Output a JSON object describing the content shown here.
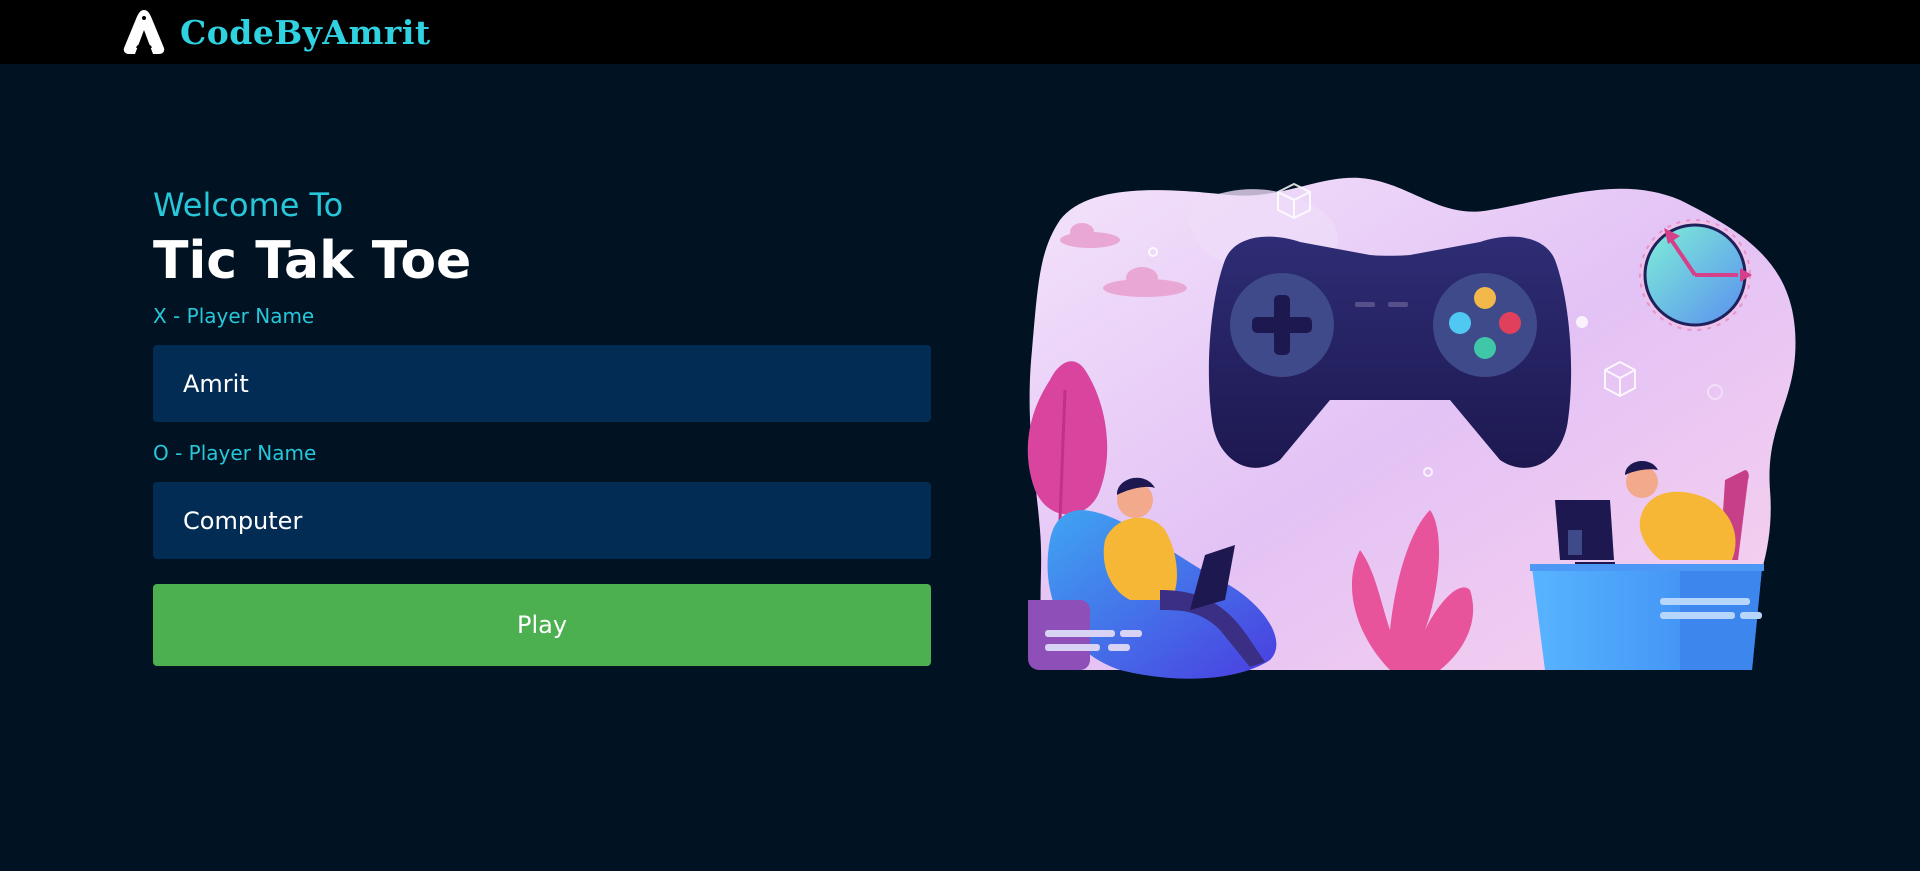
{
  "navbar": {
    "brand_name": "CodeByAmrit",
    "logo_icon": "brand-a-logo-icon"
  },
  "welcome": {
    "subtitle": "Welcome To",
    "title": "Tic Tak Toe"
  },
  "form": {
    "x_label": "X - Player Name",
    "x_value": "Amrit",
    "o_label": "O - Player Name",
    "o_value": "Computer",
    "play_label": "Play"
  },
  "colors": {
    "accent": "#27c7d9",
    "background": "#011222",
    "input_bg": "#022c54",
    "play_button": "#4caf50",
    "navbar": "#000000"
  },
  "illustration": {
    "icon": "gaming-illustration"
  }
}
